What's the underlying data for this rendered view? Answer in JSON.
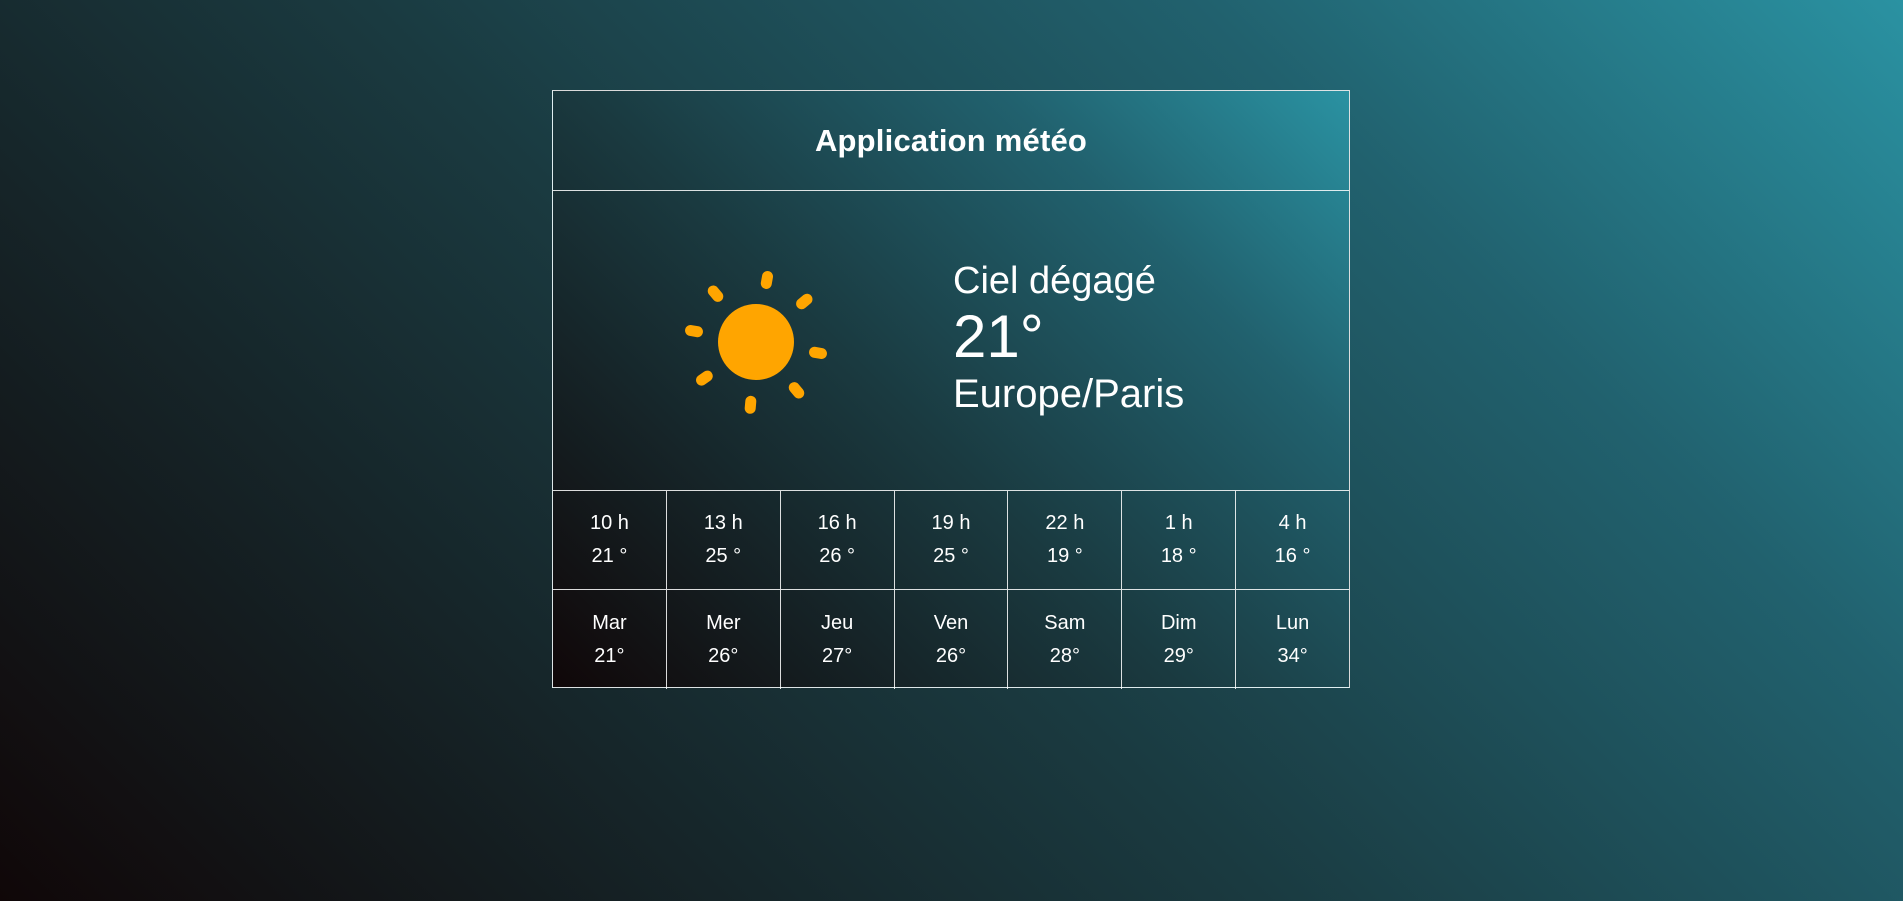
{
  "app": {
    "title": "Application météo"
  },
  "current": {
    "icon": "sun-icon",
    "condition": "Ciel dégagé",
    "temperature": "21°",
    "timezone": "Europe/Paris"
  },
  "colors": {
    "sun": "#ffa500",
    "text": "#ffffff",
    "border": "#ffffff"
  },
  "hourly": [
    {
      "time": "10 h",
      "temp": "21 °"
    },
    {
      "time": "13 h",
      "temp": "25 °"
    },
    {
      "time": "16 h",
      "temp": "26 °"
    },
    {
      "time": "19 h",
      "temp": "25 °"
    },
    {
      "time": "22 h",
      "temp": "19 °"
    },
    {
      "time": "1 h",
      "temp": "18 °"
    },
    {
      "time": "4 h",
      "temp": "16 °"
    }
  ],
  "daily": [
    {
      "day": "Mar",
      "temp": "21°"
    },
    {
      "day": "Mer",
      "temp": "26°"
    },
    {
      "day": "Jeu",
      "temp": "27°"
    },
    {
      "day": "Ven",
      "temp": "26°"
    },
    {
      "day": "Sam",
      "temp": "28°"
    },
    {
      "day": "Dim",
      "temp": "29°"
    },
    {
      "day": "Lun",
      "temp": "34°"
    }
  ]
}
